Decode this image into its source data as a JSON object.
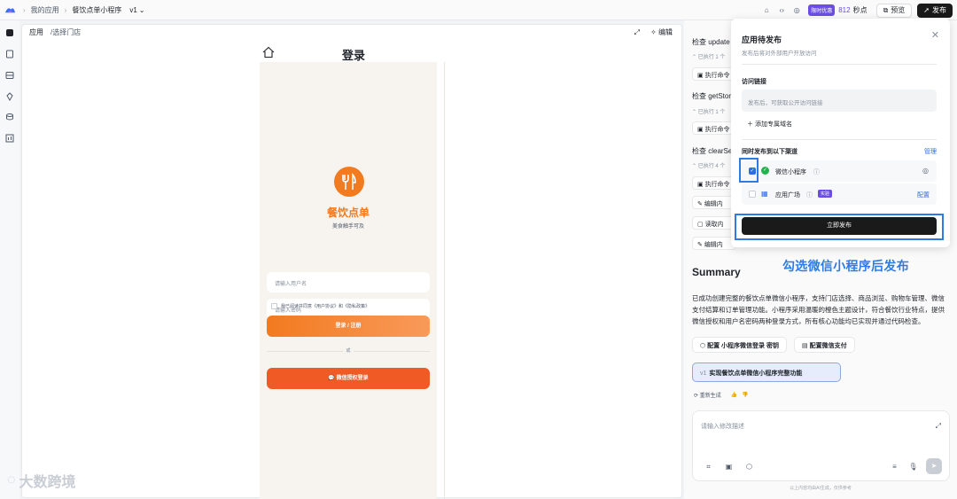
{
  "topbar": {
    "breadcrumb": [
      "我的应用",
      "餐饮点单小程序"
    ],
    "version": "v1",
    "promo_badge": "限时优惠",
    "points_value": "812",
    "points_unit": "秒点",
    "preview_label": "预览",
    "publish_label": "发布"
  },
  "preview": {
    "tab_label": "应用",
    "path": "/选择门店",
    "edit_label": "编辑",
    "page_title": "登录",
    "app_name": "餐饮点单",
    "app_subtitle": "美食触手可及",
    "username_placeholder": "请输入用户名",
    "password_placeholder": "请输入密码",
    "agreement_text": "我已阅读并同意《用户协议》和《隐私政策》",
    "login_button": "登录 / 注册",
    "or_text": "或",
    "wechat_button": "微信授权登录"
  },
  "steps": [
    {
      "title": "检查 update",
      "sub": "已执行 1 个",
      "chip": "执行命令"
    },
    {
      "title": "检查 getStor",
      "sub": "已执行 1 个",
      "chip": "执行命令"
    },
    {
      "title": "检查 clearSe",
      "sub": "已执行 4 个",
      "chip": "执行命令"
    }
  ],
  "extra_chips": [
    "编辑内",
    "读取内",
    "编辑内"
  ],
  "summary": {
    "heading": "Summary",
    "body": "已成功创建完整的餐饮点单微信小程序，支持门店选择、商品浏览、购物车管理、微信支付结算和订单管理功能。小程序采用温暖的橙色主题设计，符合餐饮行业特点，提供微信授权和用户名密码两种登录方式，所有核心功能均已实现并通过代码检查。",
    "btn_config_login": "配置 小程序微信登录 密钥",
    "btn_config_pay": "配置微信支付",
    "selected_version": "v1",
    "selected_text": "实现餐饮点单微信小程序完整功能",
    "regenerate": "重新生成"
  },
  "composer": {
    "placeholder": "请输入修改描述",
    "disclaimer": "以上内容均由AI生成，仅供参考"
  },
  "popup": {
    "title": "应用待发布",
    "subtitle": "发布后将对外部用户开放访问",
    "link_label": "访问链接",
    "link_placeholder": "发布后，可获取公开访问链接",
    "add_domain": "添加专属域名",
    "channels_label": "同时发布到以下渠道",
    "manage": "管理",
    "channel1": "微信小程序",
    "channel2": "应用广场",
    "channel2_tag": "实验",
    "configure": "配置",
    "publish_now": "立即发布"
  },
  "annotation": "勾选微信小程序后发布",
  "watermark": "大数跨境",
  "colors": {
    "accent": "#f27a1f",
    "highlight": "#2f7be5",
    "brand_purple": "#6b4de6"
  }
}
